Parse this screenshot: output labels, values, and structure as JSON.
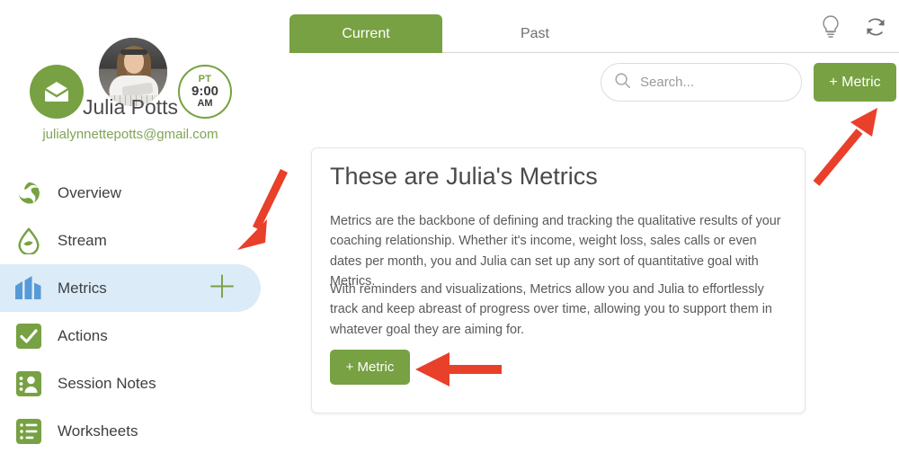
{
  "sidebar": {
    "mail_icon": "envelope-icon",
    "avatar_alt": "julia-potts-avatar",
    "timezone_badge": {
      "tz": "PT",
      "time": "9:00",
      "meridiem": "AM"
    },
    "user_name": "Julia Potts",
    "user_email": "julialynnettepotts@gmail.com",
    "items": [
      {
        "label": "Overview",
        "icon": "pinwheel-icon",
        "active": false
      },
      {
        "label": "Stream",
        "icon": "droplet-icon",
        "active": false
      },
      {
        "label": "Metrics",
        "icon": "bar-chart-icon",
        "active": true
      },
      {
        "label": "Actions",
        "icon": "check-square-icon",
        "active": false
      },
      {
        "label": "Session Notes",
        "icon": "person-card-icon",
        "active": false
      },
      {
        "label": "Worksheets",
        "icon": "list-square-icon",
        "active": false
      }
    ],
    "add_metric_plus": "plus-icon"
  },
  "header": {
    "tabs": [
      {
        "label": "Current",
        "active": true
      },
      {
        "label": "Past",
        "active": false
      }
    ],
    "icons": [
      {
        "name": "lightbulb-icon"
      },
      {
        "name": "refresh-icon"
      }
    ]
  },
  "toolbar": {
    "search": {
      "placeholder": "Search...",
      "value": "",
      "icon": "search-icon"
    },
    "add_metric_label": "+ Metric"
  },
  "card": {
    "title": "These are Julia's Metrics",
    "paragraph_1": "Metrics are the backbone of defining and tracking the qualitative results of your coaching relationship. Whether it's income, weight loss, sales calls or even dates per month, you and Julia can set up any sort of quantitative goal with Metrics.",
    "paragraph_2": "With reminders and visualizations, Metrics allow you and Julia to effortlessly track and keep abreast of progress over time, allowing you to support them in whatever goal they are aiming for.",
    "add_metric_label": "+ Metric"
  },
  "annotations": {
    "arrow_color": "#e8402a",
    "arrows": [
      {
        "name": "arrow-to-sidebar-plus",
        "direction": "down-left"
      },
      {
        "name": "arrow-to-top-add-metric",
        "direction": "up-right"
      },
      {
        "name": "arrow-to-card-add-metric",
        "direction": "left"
      }
    ]
  },
  "colors": {
    "brand_green": "#77a142",
    "active_nav_blue": "#dcebf8",
    "chart_icon_blue": "#589ad6",
    "arrow_red": "#e8402a"
  }
}
